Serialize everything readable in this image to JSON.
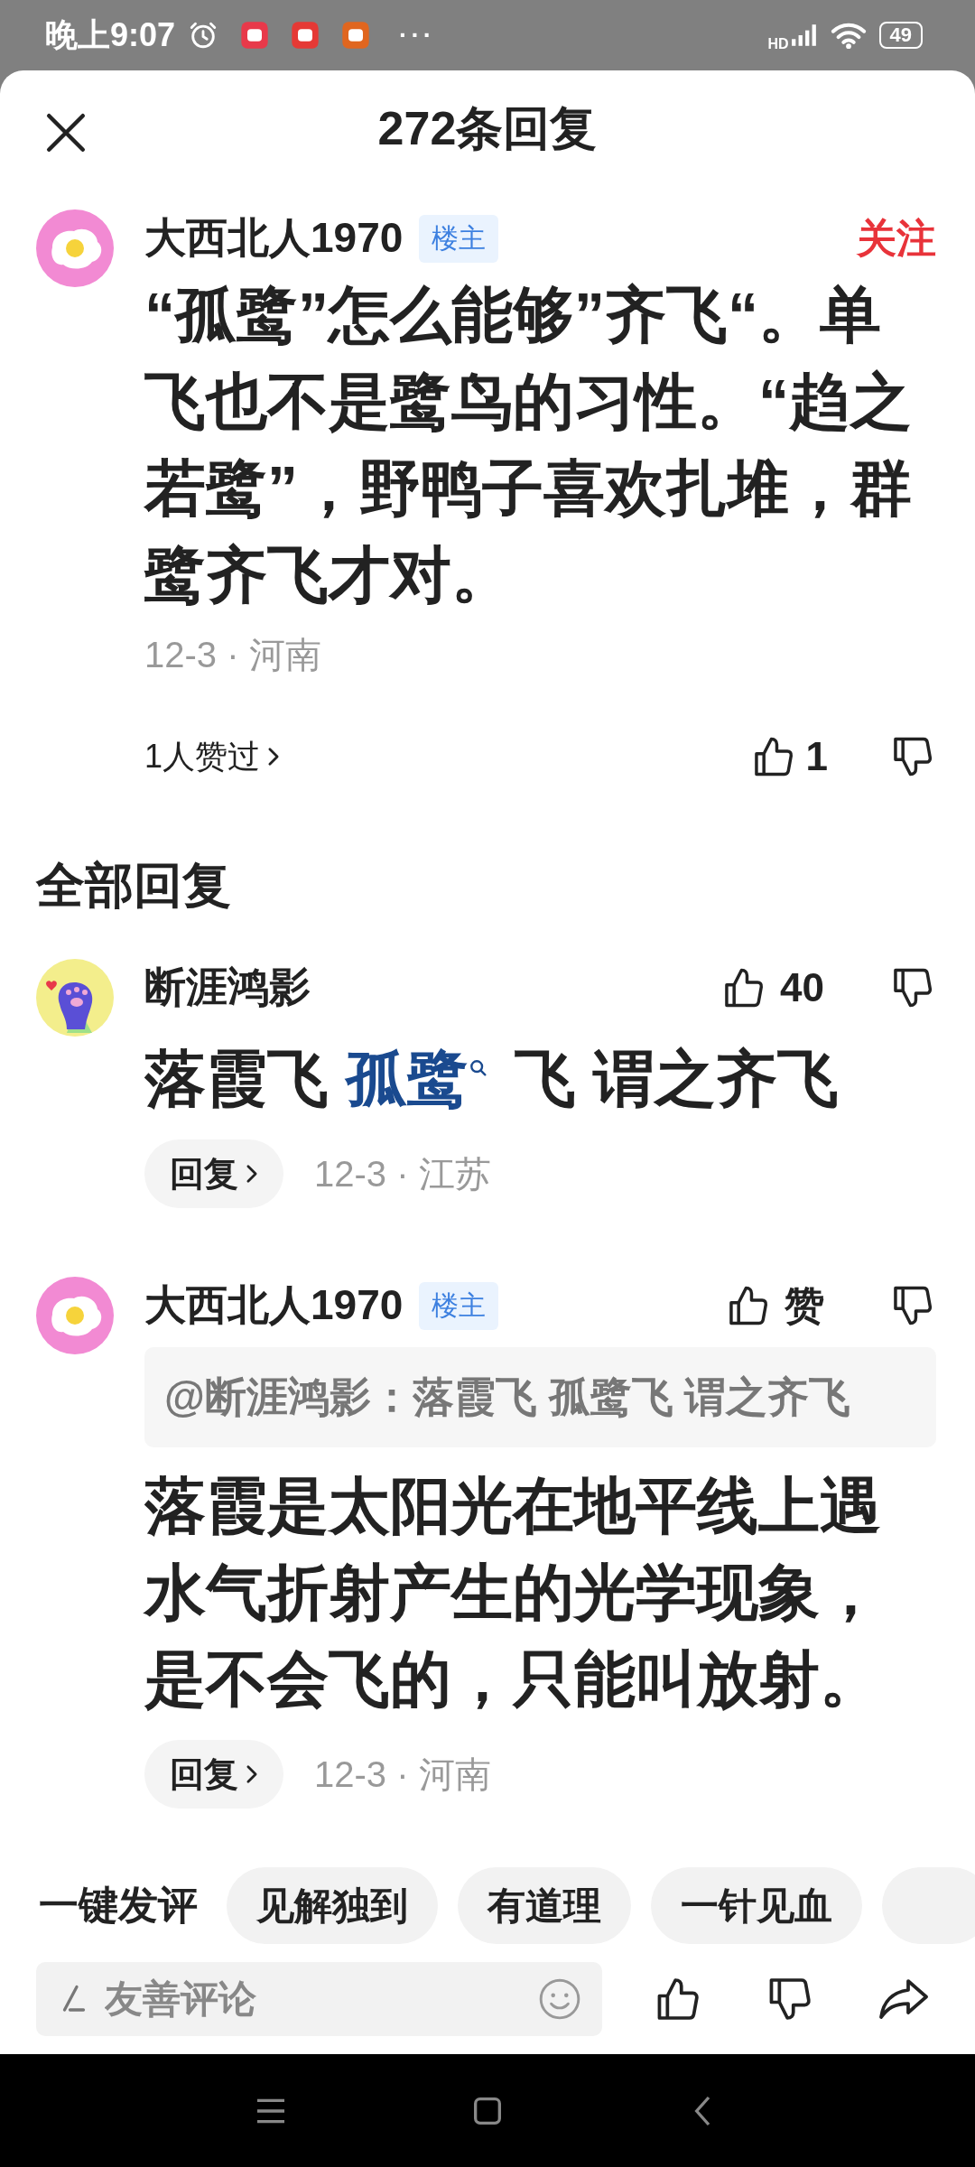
{
  "status_bar": {
    "time": "晚上9:07",
    "apps": [
      {
        "color": "#e8394a"
      },
      {
        "color": "#e53935"
      },
      {
        "color": "#e0661f"
      }
    ],
    "more": "···",
    "network": "HD",
    "battery": "49"
  },
  "header": {
    "title": "272条回复"
  },
  "main_comment": {
    "avatar": {
      "kind": "egg"
    },
    "author": "大西北人1970",
    "badge": "楼主",
    "follow": "关注",
    "text": "“孤鹭”怎么能够”齐飞“。单飞也不是鹭鸟的习性。“趋之若鹭”，野鸭子喜欢扎堆，群鹭齐飞才对。",
    "meta": "12-3 · 河南",
    "likers": "1人赞过",
    "likes": "1",
    "liked": false
  },
  "section_title": "全部回复",
  "replies": [
    {
      "avatar": {
        "kind": "paw"
      },
      "author": "断涯鸿影",
      "likes": "40",
      "liked": false,
      "segments": [
        {
          "text": "落霞飞 "
        },
        {
          "text": "孤鹭",
          "kind": "link"
        },
        {
          "text": " 飞 谓之齐飞"
        }
      ],
      "reply_button": "回复",
      "meta": "12-3 · 江苏"
    },
    {
      "avatar": {
        "kind": "egg"
      },
      "author": "大西北人1970",
      "badge": "楼主",
      "likes": "赞",
      "liked": false,
      "quote": "@断涯鸿影：落霞飞 孤鹭飞 谓之齐飞",
      "segments": [
        {
          "text": "落霞是太阳光在地平线上遇水气折射产生的光学现象，是不会飞的，只能叫放射。"
        }
      ],
      "reply_button": "回复",
      "meta": "12-3 · 河南"
    }
  ],
  "quick_replies": {
    "label": "一键发评",
    "chips": [
      "见解独到",
      "有道理",
      "一针见血"
    ],
    "cut_chip": true
  },
  "input": {
    "placeholder": "友善评论"
  }
}
